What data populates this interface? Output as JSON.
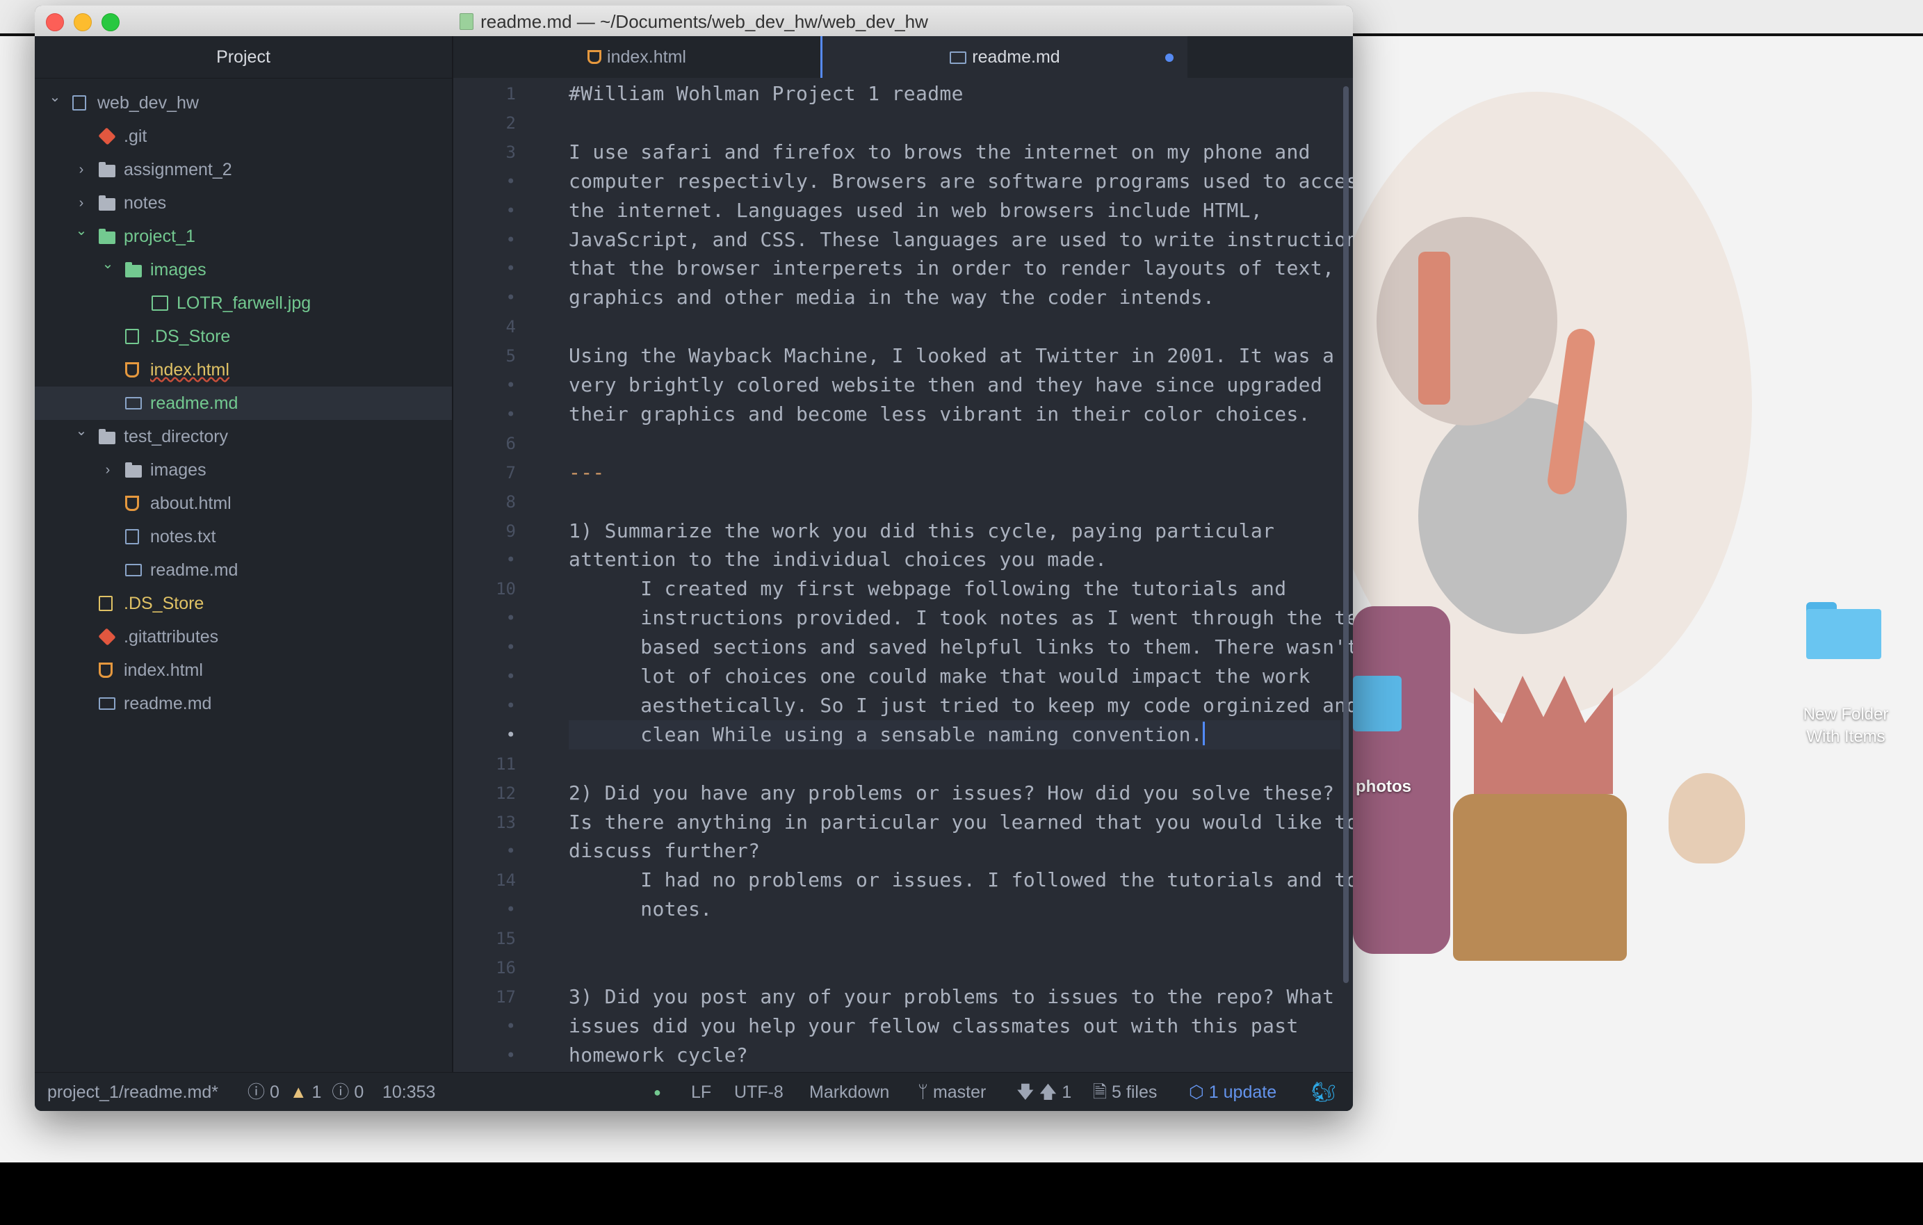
{
  "window": {
    "title": "readme.md — ~/Documents/web_dev_hw/web_dev_hw"
  },
  "sidebar": {
    "title": "Project",
    "items": [
      {
        "label": "web_dev_hw",
        "kind": "repo",
        "depth": 0,
        "expanded": true
      },
      {
        "label": ".git",
        "kind": "git",
        "depth": 1,
        "expanded": false
      },
      {
        "label": "assignment_2",
        "kind": "folder",
        "depth": 1,
        "expanded": false
      },
      {
        "label": "notes",
        "kind": "folder",
        "depth": 1,
        "expanded": false
      },
      {
        "label": "project_1",
        "kind": "folder",
        "depth": 1,
        "expanded": true,
        "status": "added"
      },
      {
        "label": "images",
        "kind": "folder",
        "depth": 2,
        "expanded": true,
        "status": "added"
      },
      {
        "label": "LOTR_farwell.jpg",
        "kind": "image",
        "depth": 3,
        "status": "added"
      },
      {
        "label": ".DS_Store",
        "kind": "ds",
        "depth": 2,
        "status": "added"
      },
      {
        "label": "index.html",
        "kind": "html",
        "depth": 2,
        "status": "modified"
      },
      {
        "label": "readme.md",
        "kind": "md",
        "depth": 2,
        "status": "added",
        "selected": true
      },
      {
        "label": "test_directory",
        "kind": "folder",
        "depth": 1,
        "expanded": true
      },
      {
        "label": "images",
        "kind": "folder",
        "depth": 2,
        "expanded": false
      },
      {
        "label": "about.html",
        "kind": "html",
        "depth": 2
      },
      {
        "label": "notes.txt",
        "kind": "txt",
        "depth": 2
      },
      {
        "label": "readme.md",
        "kind": "md",
        "depth": 2
      },
      {
        "label": ".DS_Store",
        "kind": "ds",
        "depth": 1,
        "status": "modified"
      },
      {
        "label": ".gitattributes",
        "kind": "git",
        "depth": 1
      },
      {
        "label": "index.html",
        "kind": "html",
        "depth": 1
      },
      {
        "label": "readme.md",
        "kind": "md",
        "depth": 1
      }
    ]
  },
  "tabs": [
    {
      "label": "index.html",
      "active": false
    },
    {
      "label": "readme.md",
      "active": true,
      "modified": true
    }
  ],
  "editor": {
    "lines": [
      {
        "num": "1",
        "text": "#William Wohlman Project 1 readme"
      },
      {
        "num": "2",
        "text": ""
      },
      {
        "num": "3",
        "text": "I use safari and firefox to brows the internet on my phone and"
      },
      {
        "num": "•",
        "text": "computer respectivly. Browsers are software programs used to access"
      },
      {
        "num": "•",
        "text": "the internet. Languages used in web browsers include HTML,"
      },
      {
        "num": "•",
        "text": "JavaScript, and CSS. These languages are used to write instructions"
      },
      {
        "num": "•",
        "text": "that the browser interperets in order to render layouts of text,"
      },
      {
        "num": "•",
        "text": "graphics and other media in the way the coder intends."
      },
      {
        "num": "4",
        "text": ""
      },
      {
        "num": "5",
        "text": "Using the Wayback Machine, I looked at Twitter in 2001. It was a"
      },
      {
        "num": "•",
        "text": "very brightly colored website then and they have since upgraded"
      },
      {
        "num": "•",
        "text": "their graphics and become less vibrant in their color choices."
      },
      {
        "num": "6",
        "text": ""
      },
      {
        "num": "7",
        "text": "---",
        "style": "hr"
      },
      {
        "num": "8",
        "text": ""
      },
      {
        "num": "9",
        "text": "1) Summarize the work you did this cycle, paying particular"
      },
      {
        "num": "•",
        "text": "attention to the individual choices you made."
      },
      {
        "num": "10",
        "text": "      I created my first webpage following the tutorials and"
      },
      {
        "num": "•",
        "text": "      instructions provided. I took notes as I went through the text"
      },
      {
        "num": "•",
        "text": "      based sections and saved helpful links to them. There wasn't a"
      },
      {
        "num": "•",
        "text": "      lot of choices one could make that would impact the work"
      },
      {
        "num": "•",
        "text": "      aesthetically. So I just tried to keep my code orginized and"
      },
      {
        "num": "•",
        "text": "      clean While using a sensable naming convention.",
        "cursor": true
      },
      {
        "num": "11",
        "text": ""
      },
      {
        "num": "12",
        "text": "2) Did you have any problems or issues? How did you solve these?"
      },
      {
        "num": "13",
        "text": "Is there anything in particular you learned that you would like to"
      },
      {
        "num": "•",
        "text": "discuss further?"
      },
      {
        "num": "14",
        "text": "      I had no problems or issues. I followed the tutorials and took"
      },
      {
        "num": "•",
        "text": "      notes."
      },
      {
        "num": "15",
        "text": ""
      },
      {
        "num": "16",
        "text": ""
      },
      {
        "num": "17",
        "text": "3) Did you post any of your problems to issues to the repo? What"
      },
      {
        "num": "•",
        "text": "issues did you help your fellow classmates out with this past"
      },
      {
        "num": "•",
        "text": "homework cycle?"
      }
    ]
  },
  "status": {
    "path": "project_1/readme.md*",
    "errors": "0",
    "warnings": "1",
    "infos": "0",
    "cursor_pos": "10:353",
    "line_ending": "LF",
    "encoding": "UTF-8",
    "grammar": "Markdown",
    "branch": "master",
    "behind_ahead": "1",
    "files": "5 files",
    "updates": "1 update"
  },
  "desktop": {
    "folder_label_1": "New Folder",
    "folder_label_2": "With Items",
    "photos_label": "photos"
  },
  "colors": {
    "accent": "#568af2",
    "added": "#73c990",
    "modified": "#e0c265",
    "ignored": "#9da5b4"
  }
}
